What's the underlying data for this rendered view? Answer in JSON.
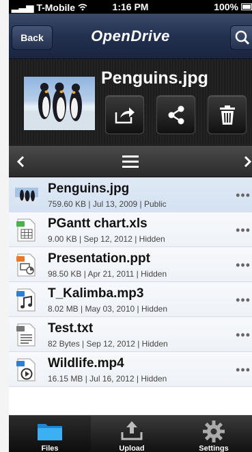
{
  "status": {
    "carrier": "T-Mobile",
    "time": "1:16 PM",
    "battery": "100%"
  },
  "nav": {
    "back_label": "Back",
    "brand": "OpenDrive"
  },
  "selected_file": {
    "title": "Penguins.jpg"
  },
  "files": [
    {
      "name": "Penguins.jpg",
      "meta": "759.60 KB | Jul 13, 2009 | Public",
      "icon": "image-thumbnail-icon"
    },
    {
      "name": "PGantt chart.xls",
      "meta": "9.00 KB | Sep 12, 2012 | Hidden",
      "icon": "spreadsheet-file-icon"
    },
    {
      "name": "Presentation.ppt",
      "meta": "98.50 KB | Apr 21, 2011 | Hidden",
      "icon": "presentation-file-icon"
    },
    {
      "name": "T_Kalimba.mp3",
      "meta": "8.02 MB | May 03, 2010 | Hidden",
      "icon": "audio-file-icon"
    },
    {
      "name": "Test.txt",
      "meta": "82 Bytes | Sep 12, 2012 | Hidden",
      "icon": "text-file-icon"
    },
    {
      "name": "Wildlife.mp4",
      "meta": "16.15 MB | Jul 16, 2012 | Hidden",
      "icon": "video-file-icon"
    }
  ],
  "more_glyph": "•••",
  "tabs": [
    {
      "label": "Files",
      "icon": "folder-icon"
    },
    {
      "label": "Upload",
      "icon": "upload-icon"
    },
    {
      "label": "Settings",
      "icon": "gear-icon"
    }
  ],
  "colors": {
    "accent_blue": "#2a9be0",
    "nav_dark": "#22304f",
    "row_selected": "#d4e2f2"
  }
}
